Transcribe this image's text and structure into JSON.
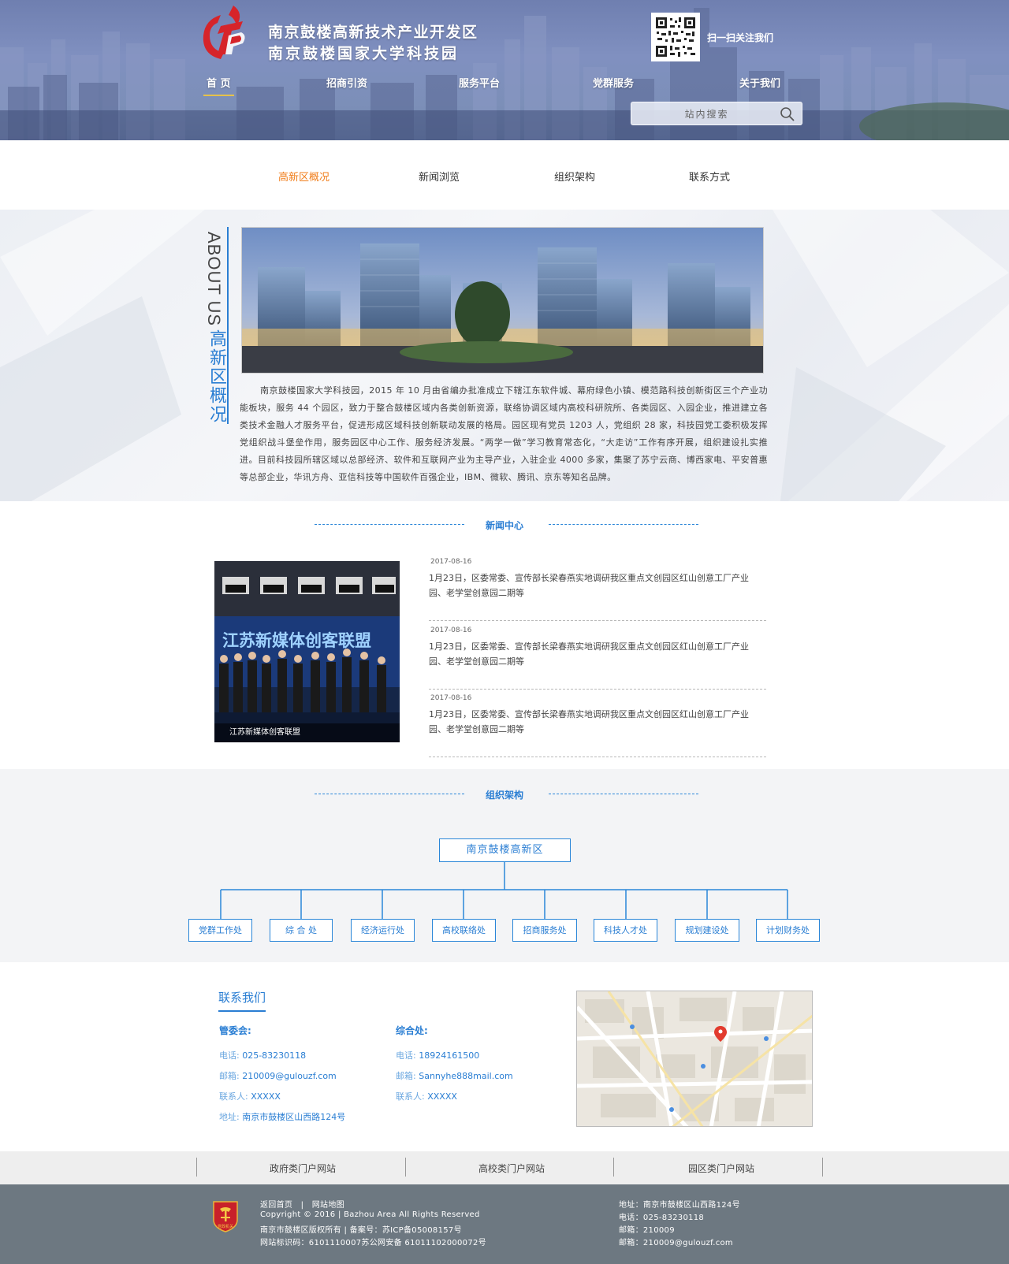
{
  "header": {
    "title_line1": "南京鼓楼高新技术产业开发区",
    "title_line2": "南京鼓楼国家大学科技园",
    "qr_label": "扫一扫关注我们",
    "nav": [
      "首 页",
      "招商引资",
      "服务平台",
      "党群服务",
      "关于我们"
    ],
    "search_placeholder": "站内搜索"
  },
  "subnav": [
    "高新区概况",
    "新闻浏览",
    "组织架构",
    "联系方式"
  ],
  "about": {
    "en_title": "ABOUT US",
    "cn_title": "高新区概况",
    "text": "南京鼓楼国家大学科技园，2015 年 10 月由省编办批准成立下辖江东软件城、幕府绿色小镇、模范路科技创新街区三个产业功能板块，服务 44 个园区，致力于整合鼓楼区域内各类创新资源，联络协调区域内高校科研院所、各类园区、入园企业，推进建立各类技术金融人才服务平台，促进形成区域科技创新联动发展的格局。园区现有党员 1203 人，党组织 28 家，科技园党工委积极发挥党组织战斗堡垒作用，服务园区中心工作、服务经济发展。“两学一做”学习教育常态化，“大走访”工作有序开展，组织建设扎实推进。目前科技园所辖区域以总部经济、软件和互联网产业为主导产业，入驻企业 4000 多家，集聚了苏宁云商、博西家电、平安普惠等总部企业，华讯方舟、亚信科技等中国软件百强企业，IBM、微软、腾讯、京东等知名品牌。"
  },
  "news": {
    "heading": "新闻中心",
    "photo_caption": "江苏新媒体创客联盟",
    "photo_banner": "江苏新媒体创客联盟",
    "items": [
      {
        "date": "2017-08-16",
        "text": "1月23日，区委常委、宣传部长梁春燕实地调研我区重点文创园区红山创意工厂产业园、老学堂创意园二期等"
      },
      {
        "date": "2017-08-16",
        "text": "1月23日，区委常委、宣传部长梁春燕实地调研我区重点文创园区红山创意工厂产业园、老学堂创意园二期等"
      },
      {
        "date": "2017-08-16",
        "text": "1月23日，区委常委、宣传部长梁春燕实地调研我区重点文创园区红山创意工厂产业园、老学堂创意园二期等"
      }
    ]
  },
  "org": {
    "heading": "组织架构",
    "root": "南京鼓楼高新区",
    "children": [
      "党群工作处",
      "综 合 处",
      "经济运行处",
      "高校联络处",
      "招商服务处",
      "科技人才处",
      "规划建设处",
      "计划财务处"
    ]
  },
  "contact": {
    "title": "联系我们",
    "col1": {
      "head": "管委会:",
      "phone_label": "电话:",
      "phone": "025-83230118",
      "email_label": "邮箱:",
      "email": "210009@gulouzf.com",
      "person_label": "联系人:",
      "person": "XXXXX",
      "address_label": "地址:",
      "address": "南京市鼓楼区山西路124号"
    },
    "col2": {
      "head": "综合处:",
      "phone_label": "电话:",
      "phone": "18924161500",
      "email_label": "邮箱:",
      "email": "Sannyhe888mail.com",
      "person_label": "联系人:",
      "person": "XXXXX"
    }
  },
  "links": [
    "政府类门户网站",
    "高校类门户网站",
    "园区类门户网站"
  ],
  "footer": {
    "home_link": "返回首页",
    "sep": "|",
    "sitemap_link": "网站地图",
    "copyright": "Copyright © 2016   |   Bazhou Area All Rights Reserved",
    "owner": "南京市鼓楼区版权所有   |   备案号：苏ICP备05008157号",
    "site_id": "网站标识码：6101110007苏公网安备 61011102000072号",
    "address": "地址：南京市鼓楼区山西路124号",
    "phone": "电话：025-83230118",
    "zip": "邮箱：210009",
    "email": "邮箱：210009@gulouzf.com",
    "emblem_text": "党政机关"
  },
  "colors": {
    "accent_blue": "#2a7ed3",
    "active_orange": "#f07d1a",
    "footer_bg": "#6d7881",
    "logo_red": "#d6242a"
  }
}
